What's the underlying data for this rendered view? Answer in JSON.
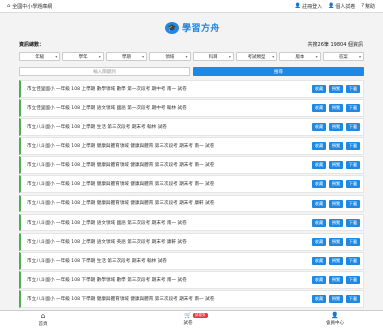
{
  "topbar": {
    "home_label": "全國中小學題庫網",
    "login": "註冊登入",
    "my_test": "個人試卷",
    "help": "幫助",
    "home_icon": "home-icon",
    "user_icon": "user-icon",
    "help_icon": "help-icon"
  },
  "logo": {
    "text": "學習方舟",
    "icon": "graduation-cap-icon"
  },
  "stats": {
    "label": "資訊總數：",
    "summary": "共搜26筆 19804 個資訊"
  },
  "filters": [
    "年級",
    "學年",
    "學期",
    "領域",
    "科目",
    "考試類型",
    "版本",
    "答案"
  ],
  "search": {
    "placeholder": "輸入關鍵詞",
    "button": "搜尋"
  },
  "actions": {
    "collect": "收藏",
    "preview": "預覽",
    "download": "下載"
  },
  "items": [
    "市立佳里國小 一年級 108 上學期 數學領域 數學 第一次段考 期中考 南一 試卷",
    "市立佳里國小 一年級 108 上學期 語文領域 國語 第一次段考 期中考 翰林 試卷",
    "市立八斗國小 一年級 108 上學期 生活 第三次段考 期末考 翰林 試卷",
    "市立八斗國小 一年級 108 上學期 健康與體育領域 健康與體育 第三次段考 期末考 南一 試卷",
    "市立八斗國小 一年級 108 上學期 健康與體育領域 健康與體育 第三次段考 期末考 南一 試卷",
    "市立八斗國小 一年級 108 上學期 健康與體育領域 健康與體育 第三次段考 期末考 南一 試卷",
    "市立八斗國小 一年級 108 上學期 健康與體育領域 健康與體育 第三次段考 期末考 康軒 試卷",
    "市立八斗國小 一年級 108 上學期 語文領域 國語 第三次段考 期末考 南一 試卷",
    "市立八斗國小 一年級 108 上學期 語文領域 英語 第三次段考 期末考 康軒 試卷",
    "市立八斗國小 一年級 108 下學期 生活 第三次段考 期末考 翰林 試卷",
    "市立八斗國小 一年級 108 下學期 數學領域 數學 第三次段考 期末考 南一 試卷",
    "市立八斗國小 一年級 108 下學期 健康與體育領域 健康與體育 第三次段考 期末考 南一 試卷"
  ],
  "bottom": {
    "home": "首頁",
    "cart": "試卷",
    "center": "會員中心",
    "badge": "試卷夾"
  }
}
